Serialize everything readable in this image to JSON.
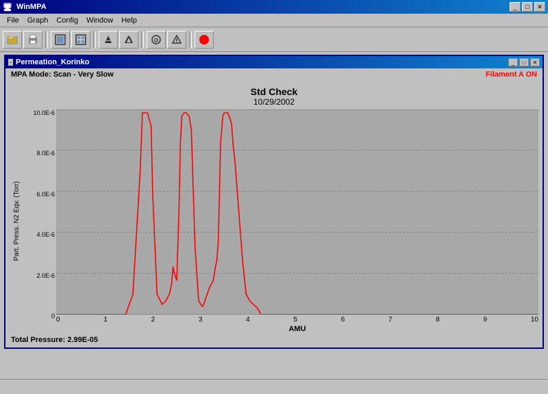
{
  "app": {
    "title": "WinMPA",
    "icon": "W"
  },
  "menu": {
    "items": [
      "File",
      "Graph",
      "Config",
      "Window",
      "Help"
    ]
  },
  "toolbar": {
    "buttons": [
      "📁",
      "🖨",
      "⬛",
      "⬛",
      "⬛",
      "⬛",
      "⬛",
      "⬛",
      "🔴"
    ]
  },
  "inner_window": {
    "title": "Permeation_Korinko",
    "mpa_mode": "MPA Mode: Scan - Very Slow",
    "filament": "Filament A ON"
  },
  "chart": {
    "title": "Std Check",
    "subtitle": "10/29/2002",
    "y_axis_label": "Part. Press. N2 Eqv. (Torr)",
    "x_axis_label": "AMU",
    "y_ticks": [
      "0",
      "2.0E-6",
      "4.0E-6",
      "6.0E-6",
      "8.0E-6",
      "10.0E-6"
    ],
    "x_ticks": [
      "0",
      "1",
      "2",
      "3",
      "4",
      "5",
      "6",
      "7",
      "8",
      "9",
      "10"
    ]
  },
  "status": {
    "total_pressure": "Total Pressure: 2.99E-05"
  },
  "title_buttons": {
    "minimize": "_",
    "maximize": "□",
    "close": "✕"
  }
}
